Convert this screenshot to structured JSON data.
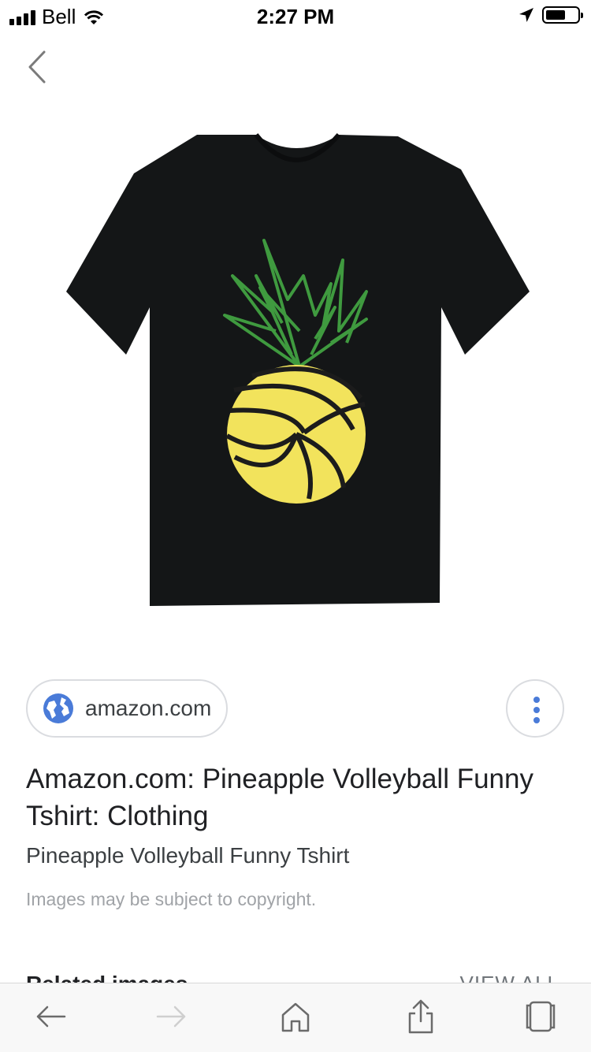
{
  "status_bar": {
    "carrier": "Bell",
    "time": "2:27 PM",
    "signal_bars": 4,
    "battery_level": 0.5,
    "icons": [
      "signal-icon",
      "wifi-icon",
      "location-arrow-icon",
      "battery-icon"
    ]
  },
  "nav": {
    "back_icon": "chevron-left-icon"
  },
  "image": {
    "subject": "black-tshirt-pineapple-volleyball",
    "colors": {
      "shirt": "#141617",
      "leaves": "#3f9a3f",
      "ball": "#f2e35c",
      "ball_lines": "#1c1c1c"
    }
  },
  "source": {
    "domain": "amazon.com",
    "icon": "globe-icon",
    "icon_color": "#4a7bd8"
  },
  "more_menu": {
    "icon": "more-vert-icon"
  },
  "result": {
    "title": "Amazon.com: Pineapple Volleyball Funny Tshirt: Clothing",
    "subtitle": "Pineapple Volleyball Funny Tshirt",
    "copyright_notice": "Images may be subject to copyright."
  },
  "related": {
    "title": "Related images",
    "view_all": "VIEW ALL"
  },
  "toolbar": {
    "items": [
      {
        "name": "back",
        "icon": "arrow-left-icon",
        "enabled": true
      },
      {
        "name": "forward",
        "icon": "arrow-right-icon",
        "enabled": false
      },
      {
        "name": "home",
        "icon": "home-icon",
        "enabled": true
      },
      {
        "name": "share",
        "icon": "share-icon",
        "enabled": true
      },
      {
        "name": "tabs",
        "icon": "tabs-icon",
        "enabled": true
      }
    ]
  }
}
